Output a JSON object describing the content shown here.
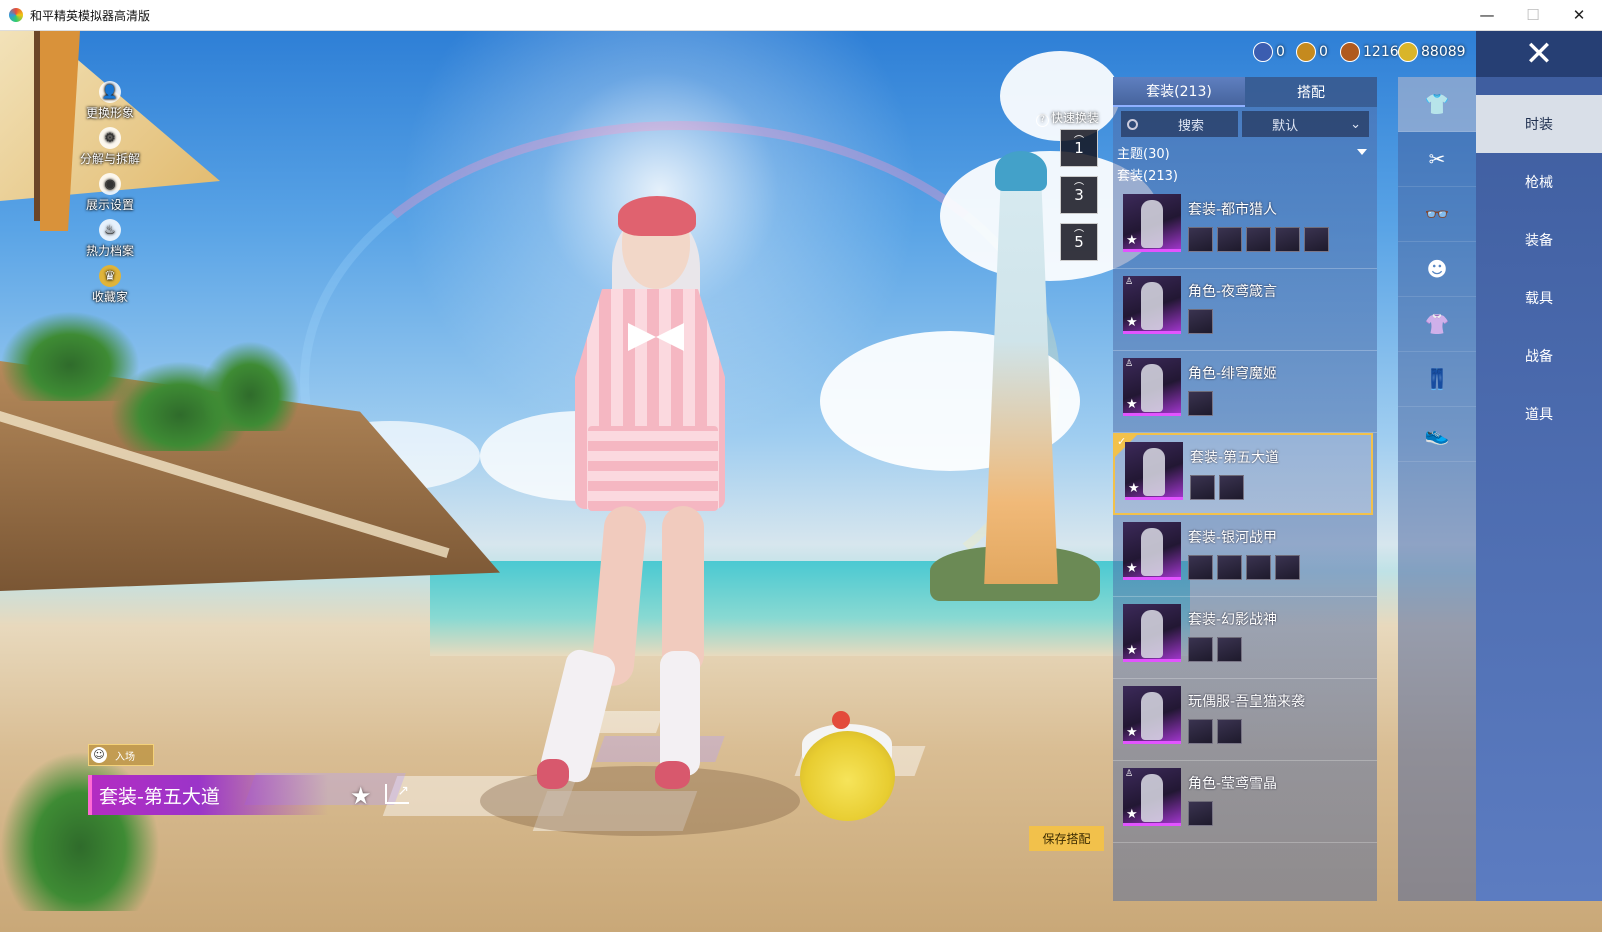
{
  "window": {
    "title": "和平精英模拟器高清版",
    "minimize": "—",
    "maximize": "☐",
    "close": "✕"
  },
  "currencies": [
    {
      "icon": "globe-coin-icon",
      "value": "0",
      "color": "#3b5db0"
    },
    {
      "icon": "gold-token-icon",
      "value": "0",
      "color": "#c58a1e"
    },
    {
      "icon": "bronze-coin-icon",
      "value": "1216",
      "color": "#b05a1e"
    },
    {
      "icon": "gem-coin-icon",
      "value": "88089",
      "color": "#d9b52a"
    }
  ],
  "left_menu": [
    {
      "label": "更换形象",
      "icon": "person-icon"
    },
    {
      "label": "分解与拆解",
      "icon": "gear-icon"
    },
    {
      "label": "展示设置",
      "icon": "eye-icon"
    },
    {
      "label": "热力档案",
      "icon": "fire-icon"
    },
    {
      "label": "收藏家",
      "icon": "crown-icon"
    }
  ],
  "quick_change": {
    "label": "快速换装",
    "slots": [
      "1",
      "3",
      "5"
    ]
  },
  "showcase": {
    "entry_tag": "入场",
    "outfit_name": "套装-第五大道"
  },
  "panel": {
    "tabs": [
      "套装(213)",
      "搭配"
    ],
    "active_tab": 0,
    "search_placeholder": "搜索",
    "sort_value": "默认",
    "theme_filter": "主题(30)",
    "suit_count": "套装(213)",
    "items": [
      {
        "name": "套装-都市猎人",
        "subs": 5,
        "role": false,
        "selected": false
      },
      {
        "name": "角色-夜鸢箴言",
        "subs": 1,
        "role": true,
        "selected": false
      },
      {
        "name": "角色-绯穹魔姬",
        "subs": 1,
        "role": true,
        "selected": false
      },
      {
        "name": "套装-第五大道",
        "subs": 2,
        "role": false,
        "selected": true
      },
      {
        "name": "套装-银河战甲",
        "subs": 4,
        "role": false,
        "selected": false
      },
      {
        "name": "套装-幻影战神",
        "subs": 2,
        "role": false,
        "selected": false
      },
      {
        "name": "玩偶服-吾皇猫来袭",
        "subs": 2,
        "role": false,
        "selected": false
      },
      {
        "name": "角色-莹鸢雪晶",
        "subs": 1,
        "role": true,
        "selected": false
      }
    ],
    "save_button": "保存搭配"
  },
  "sub_categories": [
    {
      "icon": "full-outfit-icon",
      "active": true
    },
    {
      "icon": "hair-icon",
      "active": false
    },
    {
      "icon": "glasses-icon",
      "active": false
    },
    {
      "icon": "mask-icon",
      "active": false
    },
    {
      "icon": "top-icon",
      "active": false
    },
    {
      "icon": "pants-icon",
      "active": false
    },
    {
      "icon": "shoes-icon",
      "active": false
    }
  ],
  "main_categories": {
    "close": "✕",
    "items": [
      "时装",
      "枪械",
      "装备",
      "载具",
      "战备",
      "道具"
    ],
    "active": 0
  }
}
